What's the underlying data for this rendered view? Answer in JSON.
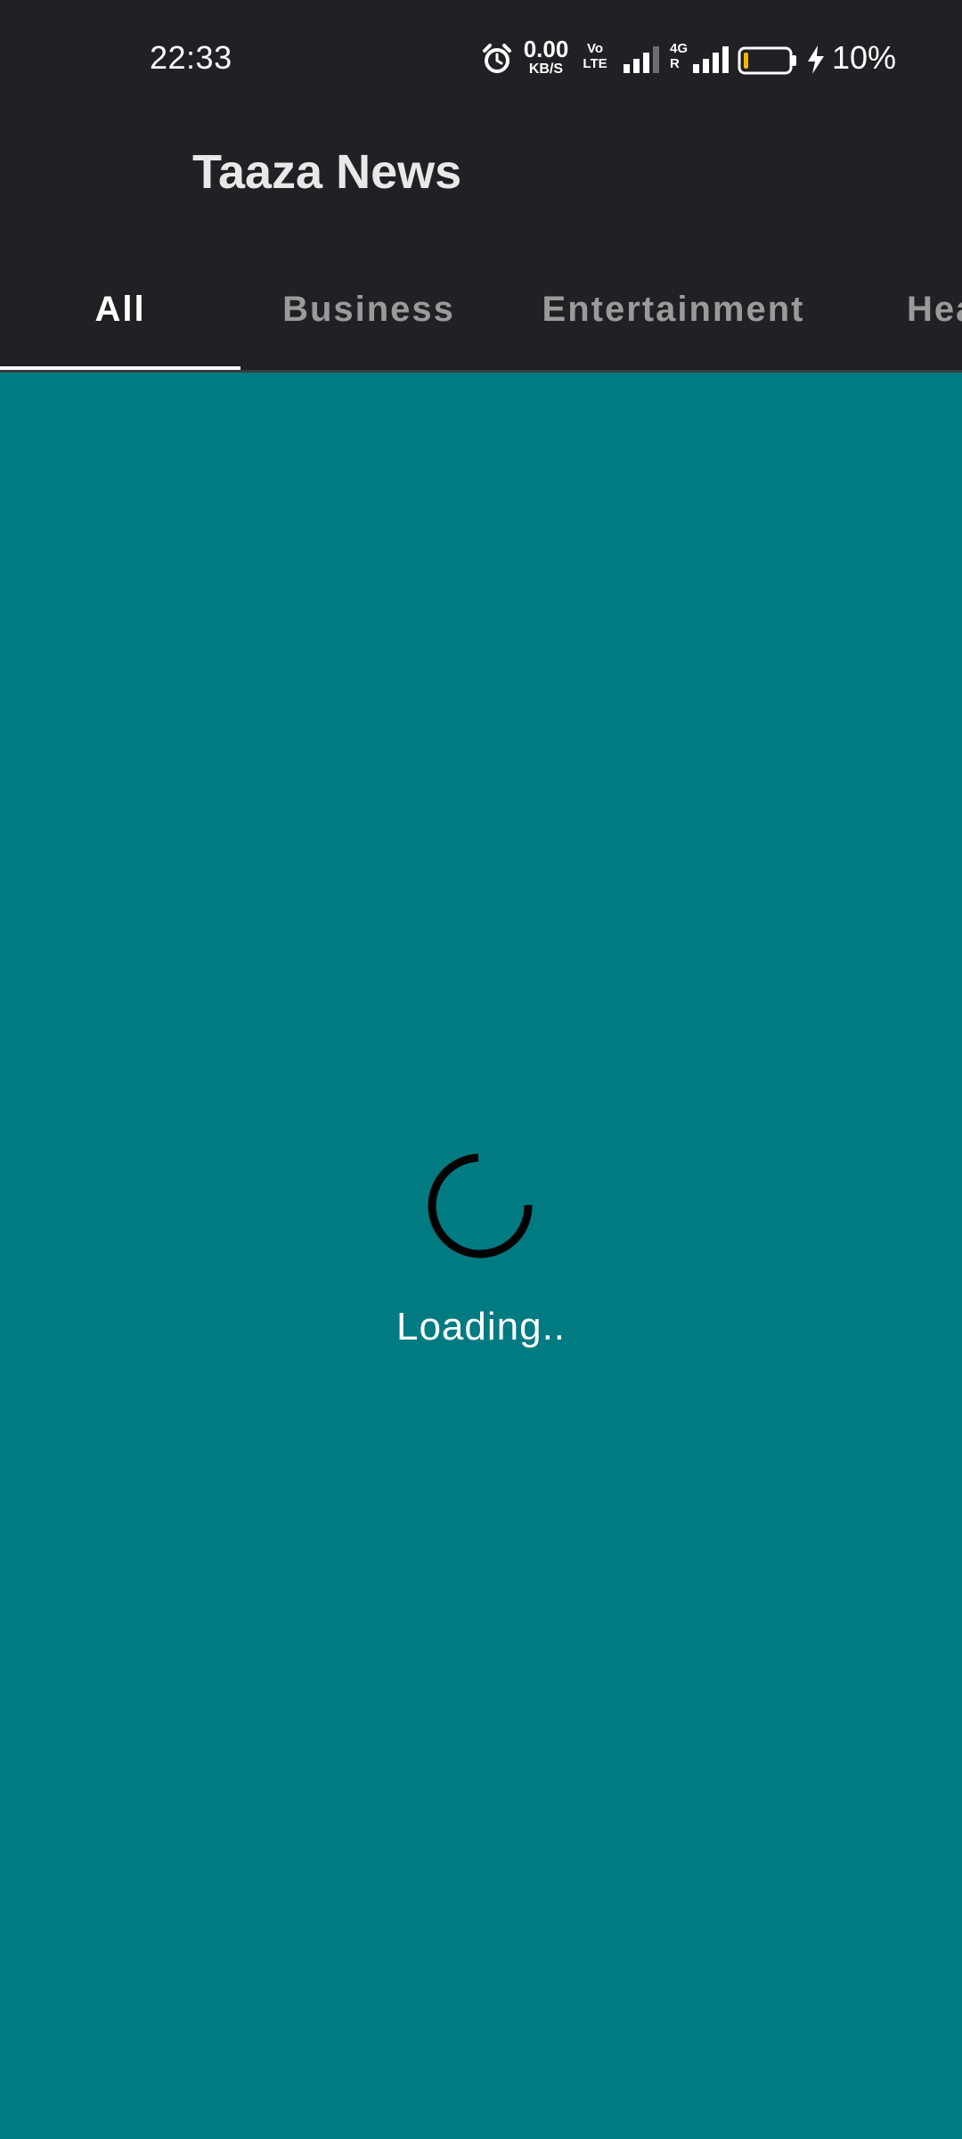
{
  "status_bar": {
    "time": "22:33",
    "net_speed_value": "0.00",
    "net_speed_unit": "KB/S",
    "volte_line1": "Vo",
    "volte_line2": "LTE",
    "network_line1": "4G",
    "network_line2": "R",
    "battery_percent": "10%",
    "battery_level": 0.1,
    "charging": true,
    "icons": [
      "alarm-icon",
      "signal-icon",
      "battery-icon",
      "charging-bolt-icon"
    ]
  },
  "app_bar": {
    "title": "Taaza News"
  },
  "tabs": [
    {
      "label": "All",
      "active": true
    },
    {
      "label": "Business",
      "active": false
    },
    {
      "label": "Entertainment",
      "active": false
    },
    {
      "label": "Hea",
      "active": false
    }
  ],
  "main": {
    "loading_text": "Loading.."
  },
  "colors": {
    "bar_background": "#202124",
    "content_background": "#007b82",
    "tab_inactive": "#9a9a9a",
    "tab_active": "#ffffff",
    "battery_fill": "#f4b400",
    "spinner": "#000000"
  }
}
